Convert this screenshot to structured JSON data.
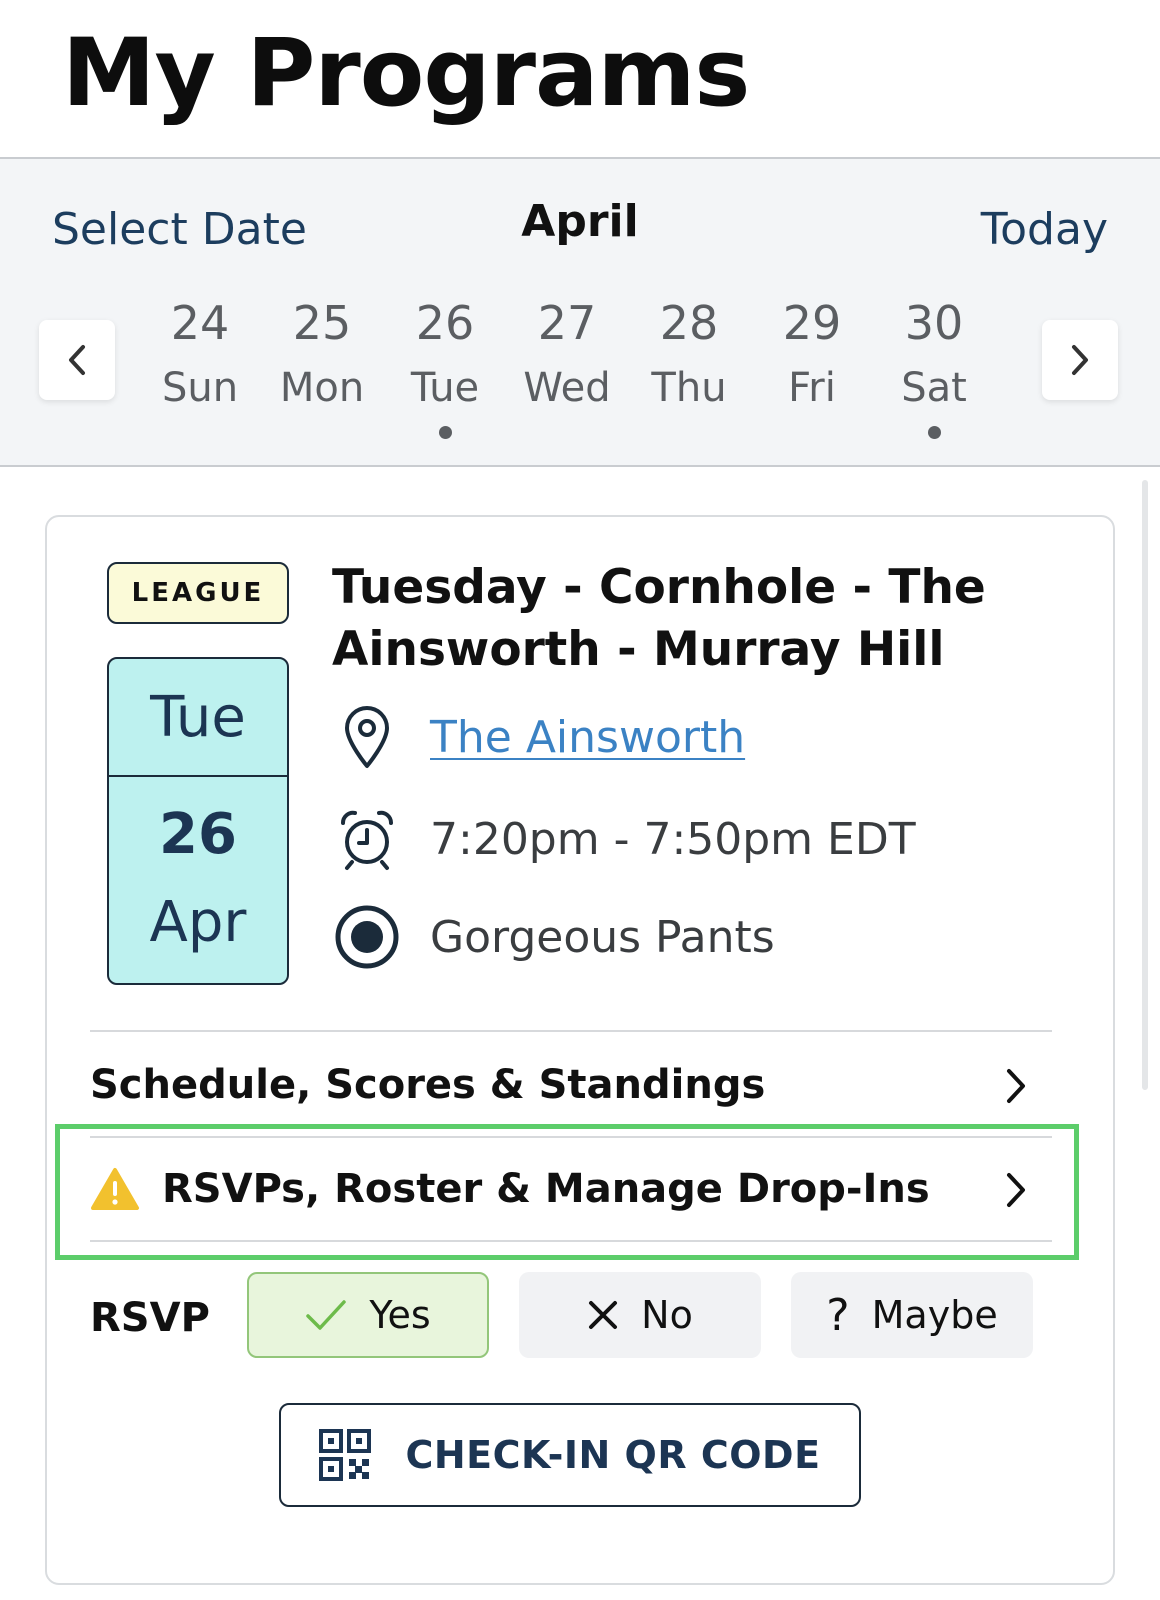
{
  "header": {
    "title": "My Programs"
  },
  "date_bar": {
    "select_date_label": "Select Date",
    "month": "April",
    "today_label": "Today",
    "prev_icon": "chevron-left-icon",
    "next_icon": "chevron-right-icon",
    "days": [
      {
        "num": "24",
        "dow": "Sun",
        "has_event": false
      },
      {
        "num": "25",
        "dow": "Mon",
        "has_event": false
      },
      {
        "num": "26",
        "dow": "Tue",
        "has_event": true
      },
      {
        "num": "27",
        "dow": "Wed",
        "has_event": false
      },
      {
        "num": "28",
        "dow": "Thu",
        "has_event": false
      },
      {
        "num": "29",
        "dow": "Fri",
        "has_event": false
      },
      {
        "num": "30",
        "dow": "Sat",
        "has_event": true
      }
    ]
  },
  "event": {
    "badge": "LEAGUE",
    "date": {
      "dow": "Tue",
      "day": "26",
      "month": "Apr"
    },
    "title": "Tuesday - Cornhole - The Ainsworth - Murray Hill",
    "venue": "The Ainsworth",
    "time": "7:20pm - 7:50pm EDT",
    "team": "Gorgeous Pants"
  },
  "links": {
    "schedule": "Schedule, Scores & Standings",
    "rsvps": "RSVPs, Roster & Manage Drop-Ins"
  },
  "rsvp": {
    "label": "RSVP",
    "yes": "Yes",
    "no": "No",
    "maybe": "Maybe",
    "selected": "Yes"
  },
  "checkin": {
    "label": "CHECK-IN QR CODE"
  },
  "colors": {
    "highlight": "#5ccd6a",
    "link": "#3b82c4",
    "date_tile": "#bdf1ef",
    "badge_bg": "#fbfad8",
    "warning": "#f2c12e"
  }
}
